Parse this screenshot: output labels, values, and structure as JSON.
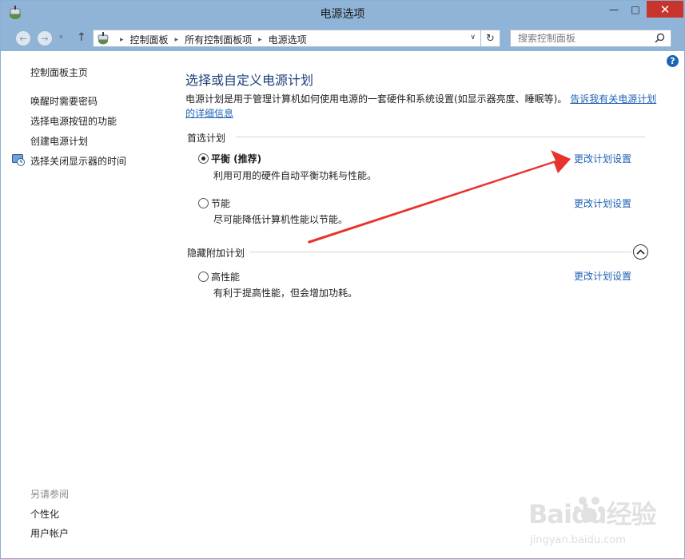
{
  "window": {
    "title": "电源选项",
    "min_glyph": "—",
    "max_glyph": "□",
    "close_glyph": "✕"
  },
  "address": {
    "back_glyph": "←",
    "forward_glyph": "→",
    "dropdown_glyph": "▾",
    "up_glyph": "↑",
    "crumbs": [
      "控制面板",
      "所有控制面板项",
      "电源选项"
    ],
    "separator": "▸",
    "chevron_glyph": "∨",
    "refresh_glyph": "↻",
    "search_placeholder": "搜索控制面板"
  },
  "help": {
    "glyph": "?"
  },
  "sidebar": {
    "home": "控制面板主页",
    "links": [
      "唤醒时需要密码",
      "选择电源按钮的功能",
      "创建电源计划",
      "选择关闭显示器的时间"
    ],
    "see_also_title": "另请参阅",
    "see_also": [
      "个性化",
      "用户帐户"
    ]
  },
  "main": {
    "title": "选择或自定义电源计划",
    "description": "电源计划是用于管理计算机如何使用电源的一套硬件和系统设置(如显示器亮度、睡眠等)。",
    "learn_more": "告诉我有关电源计划的详细信息",
    "preferred_section": "首选计划",
    "hidden_section": "隐藏附加计划",
    "plans": [
      {
        "name": "平衡 (推荐)",
        "desc": "利用可用的硬件自动平衡功耗与性能。",
        "link": "更改计划设置",
        "selected": true
      },
      {
        "name": "节能",
        "desc": "尽可能降低计算机性能以节能。",
        "link": "更改计划设置",
        "selected": false
      },
      {
        "name": "高性能",
        "desc": "有利于提高性能，但会增加功耗。",
        "link": "更改计划设置",
        "selected": false
      }
    ]
  },
  "annotation": {
    "arrow_color": "#e8322e"
  },
  "watermark": {
    "brand": "Baidu经验",
    "url": "jingyan.baidu.com"
  },
  "colors": {
    "titlebar": "#8fb4d8",
    "link": "#1f62b5",
    "heading": "#1d3f7a",
    "close": "#c7342b"
  }
}
